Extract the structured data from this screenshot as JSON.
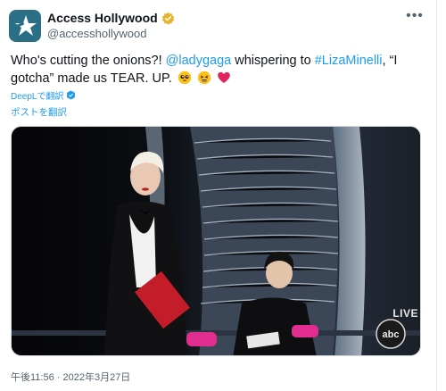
{
  "account": {
    "display_name": "Access Hollywood",
    "handle": "@accesshollywood",
    "verified": true,
    "avatar_icon": "star-logo-icon",
    "brand_color": "#2a6f86"
  },
  "tweet": {
    "text_part1": "Who's cutting the onions?! ",
    "mention": "@ladygaga",
    "text_part2": " whispering to ",
    "hashtag": "#LizaMinelli",
    "text_part3": ", “I gotcha” made us TEAR. UP.",
    "emojis": [
      "pleading-face",
      "persevering-face",
      "red-heart"
    ]
  },
  "deepl": {
    "label": "DeepLで翻訳"
  },
  "translate": {
    "label": "ポストを翻訳"
  },
  "media": {
    "live_label": "LIVE",
    "network_logo": "abc"
  },
  "meta": {
    "timestamp": "午後11:56 · 2022年3月27日"
  },
  "colors": {
    "link": "#1d9bf0",
    "text": "#0f1419",
    "muted": "#536471"
  }
}
